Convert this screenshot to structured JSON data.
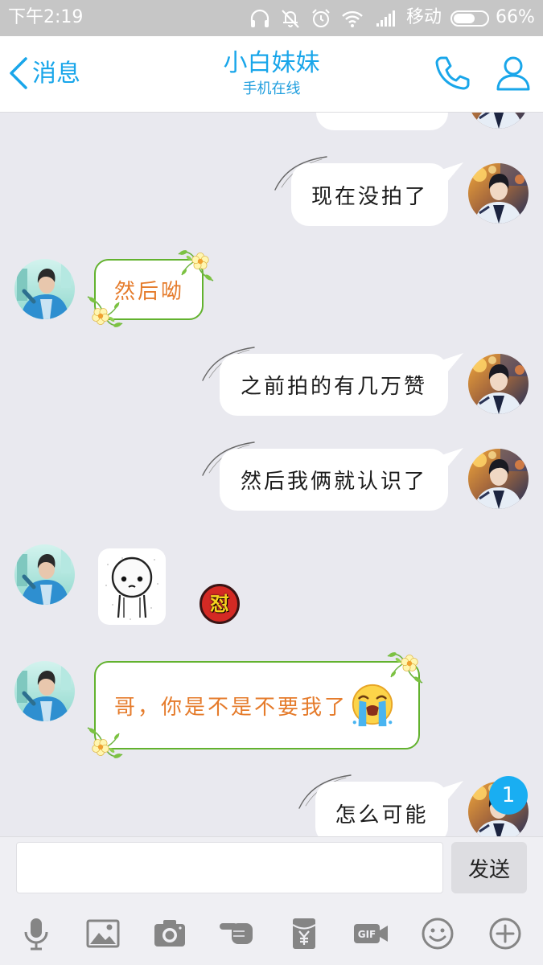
{
  "status_bar": {
    "time": "下午2:19",
    "carrier": "移动",
    "battery_percent": "66%",
    "battery_level": 0.66,
    "icons": [
      "headphones-icon",
      "silent-mode-icon",
      "alarm-icon",
      "wifi-icon",
      "signal-icon",
      "battery-icon"
    ]
  },
  "header": {
    "back_label": "消息",
    "title": "小白妹妹",
    "subtitle": "手机在线",
    "icons": [
      "back-chevron-icon",
      "phone-call-icon",
      "profile-icon"
    ]
  },
  "messages": [
    {
      "outgoing": true,
      "partially_visible": true
    },
    {
      "outgoing": true,
      "text": "现在没拍了"
    },
    {
      "outgoing": false,
      "themed_bubble": true,
      "text": "然后呦"
    },
    {
      "outgoing": true,
      "text": "之前拍的有几万赞"
    },
    {
      "outgoing": true,
      "text": "然后我俩就认识了"
    },
    {
      "outgoing": false,
      "sticker_icon": "blank-face-sticker-icon",
      "reaction_sticker_text": "怼"
    },
    {
      "outgoing": false,
      "themed_bubble": true,
      "text": "哥，你是不是不要我了",
      "emoji_icon": "crying-face-icon"
    },
    {
      "outgoing": true,
      "text": "怎么可能",
      "unread_badge": "1"
    }
  ],
  "composer": {
    "input_value": "",
    "send_label": "发送"
  },
  "toolbar": {
    "icons": [
      "microphone-icon",
      "image-icon",
      "camera-icon",
      "poke-hand-icon",
      "red-packet-icon",
      "gif-icon",
      "emoji-smiley-icon",
      "plus-circle-icon"
    ],
    "gif_label": "GIF"
  },
  "colors": {
    "accent": "#19a6ea",
    "status_bar": "#c6c6c6",
    "chat_background": "#e9e9ef",
    "themed_bubble_border": "#62b22e",
    "themed_text": "#e57b2b",
    "unread_badge": "#19aef2",
    "toolbar_icon": "#858585"
  }
}
